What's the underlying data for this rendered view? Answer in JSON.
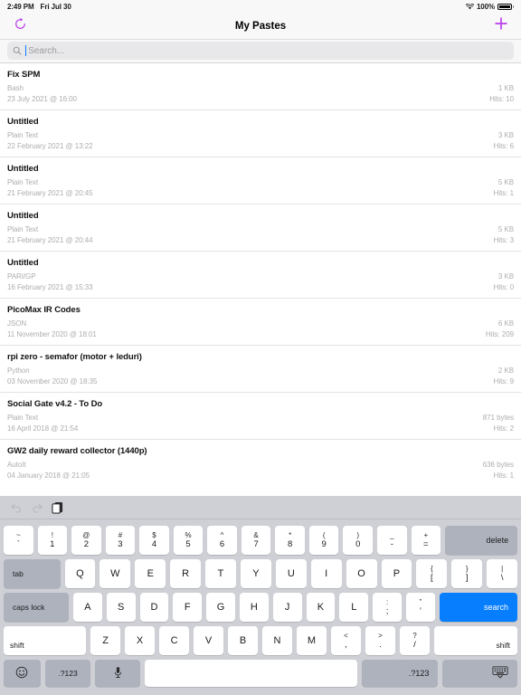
{
  "status_bar": {
    "time": "2:49 PM",
    "date": "Fri Jul 30",
    "wifi_icon": "wifi-icon",
    "battery_percent": "100%",
    "battery_icon": "battery-full-icon"
  },
  "nav": {
    "title": "My Pastes",
    "refresh_icon": "refresh-icon",
    "add_icon": "plus-icon",
    "accent_color": "#b73fe8"
  },
  "search": {
    "placeholder": "Search...",
    "value": "",
    "icon": "search-icon",
    "caret_color": "#0a7bff"
  },
  "list": {
    "items": [
      {
        "title": "Fix SPM",
        "language": "Bash",
        "date": "23 July 2021 @ 16:00",
        "size": "1 KB",
        "hits": "Hits: 10"
      },
      {
        "title": "Untitled",
        "language": "Plain Text",
        "date": "22 February 2021 @ 13:22",
        "size": "3 KB",
        "hits": "Hits: 6"
      },
      {
        "title": "Untitled",
        "language": "Plain Text",
        "date": "21 February 2021 @ 20:45",
        "size": "5 KB",
        "hits": "Hits: 1"
      },
      {
        "title": "Untitled",
        "language": "Plain Text",
        "date": "21 February 2021 @ 20:44",
        "size": "5 KB",
        "hits": "Hits: 3"
      },
      {
        "title": "Untitled",
        "language": "PARI/GP",
        "date": "16 February 2021 @ 15:33",
        "size": "3 KB",
        "hits": "Hits: 0"
      },
      {
        "title": "PicoMax IR Codes",
        "language": "JSON",
        "date": "11 November 2020 @ 18:01",
        "size": "6 KB",
        "hits": "Hits: 209"
      },
      {
        "title": "rpi zero - semafor (motor + leduri)",
        "language": "Python",
        "date": "03 November 2020 @ 18:35",
        "size": "2 KB",
        "hits": "Hits: 9"
      },
      {
        "title": "Social Gate v4.2 - To Do",
        "language": "Plain Text",
        "date": "16 April 2018 @ 21:54",
        "size": "871 bytes",
        "hits": "Hits: 2"
      },
      {
        "title": "GW2 daily reward collector (1440p)",
        "language": "AutoIt",
        "date": "04 January 2018 @ 21:05",
        "size": "636 bytes",
        "hits": "Hits: 1"
      }
    ]
  },
  "keyboard": {
    "toolbar": {
      "undo_icon": "undo-arrow-icon",
      "redo_icon": "redo-arrow-icon",
      "paste_icon": "paste-clipboard-icon"
    },
    "row_numbers": [
      {
        "sup": "~",
        "sub": "`"
      },
      {
        "sup": "!",
        "sub": "1"
      },
      {
        "sup": "@",
        "sub": "2"
      },
      {
        "sup": "#",
        "sub": "3"
      },
      {
        "sup": "$",
        "sub": "4"
      },
      {
        "sup": "%",
        "sub": "5"
      },
      {
        "sup": "^",
        "sub": "6"
      },
      {
        "sup": "&",
        "sub": "7"
      },
      {
        "sup": "*",
        "sub": "8"
      },
      {
        "sup": "(",
        "sub": "9"
      },
      {
        "sup": ")",
        "sub": "0"
      },
      {
        "sup": "_",
        "sub": "-"
      },
      {
        "sup": "+",
        "sub": "="
      }
    ],
    "delete_label": "delete",
    "tab_label": "tab",
    "row_top": [
      "Q",
      "W",
      "E",
      "R",
      "T",
      "Y",
      "U",
      "I",
      "O",
      "P"
    ],
    "row_top_dual": [
      {
        "sup": "{",
        "sub": "["
      },
      {
        "sup": "}",
        "sub": "]"
      },
      {
        "sup": "|",
        "sub": "\\"
      }
    ],
    "capslock_label": "caps lock",
    "row_home": [
      "A",
      "S",
      "D",
      "F",
      "G",
      "H",
      "J",
      "K",
      "L"
    ],
    "row_home_dual": [
      {
        "sup": ":",
        "sub": ";"
      },
      {
        "sup": "”",
        "sub": "’"
      }
    ],
    "search_label": "search",
    "shift_left_label": "shift",
    "row_bottom": [
      "Z",
      "X",
      "C",
      "V",
      "B",
      "N",
      "M"
    ],
    "row_bottom_dual": [
      {
        "sup": "<",
        "sub": ","
      },
      {
        "sup": ">",
        "sub": "."
      },
      {
        "sup": "?",
        "sub": "/"
      }
    ],
    "shift_right_label": "shift",
    "emoji_icon": "emoji-smiley-icon",
    "numeric_left_label": ".?123",
    "mic_icon": "microphone-icon",
    "space_label": "",
    "numeric_right_label": ".?123",
    "dismiss_icon": "hide-keyboard-icon",
    "search_key_color": "#067efd"
  }
}
